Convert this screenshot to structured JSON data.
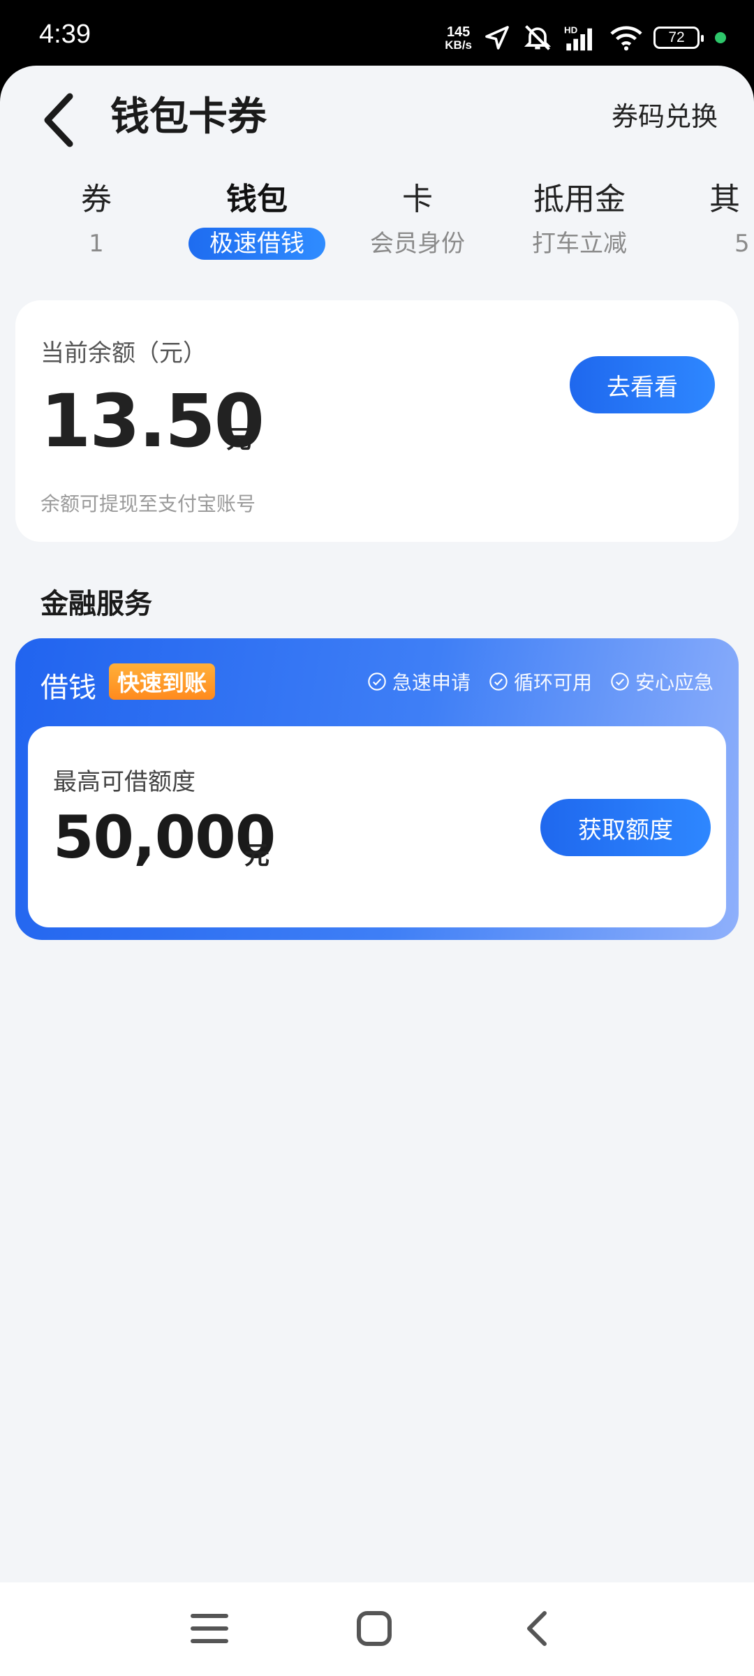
{
  "status_bar": {
    "time": "4:39",
    "net_speed_value": "145",
    "net_speed_unit": "KB/s",
    "battery": "72",
    "icons": [
      "location-arrow-icon",
      "mute-icon",
      "hd-signal-icon",
      "wifi-icon",
      "battery-icon",
      "green-dot-icon"
    ]
  },
  "header": {
    "title": "钱包卡券",
    "action_label": "券码兑换"
  },
  "tabs": [
    {
      "title": "券",
      "subtitle": "1"
    },
    {
      "title": "钱包",
      "subtitle": "极速借钱"
    },
    {
      "title": "卡",
      "subtitle": "会员身份"
    },
    {
      "title": "抵用金",
      "subtitle": "打车立减"
    },
    {
      "title": "其",
      "subtitle": "5"
    }
  ],
  "balance": {
    "label": "当前余额（元）",
    "amount": "13.50",
    "unit": "元",
    "note": "余额可提现至支付宝账号",
    "button_label": "去看看"
  },
  "finance": {
    "section_title": "金融服务",
    "loan_title": "借钱",
    "loan_tag": "快速到账",
    "features": [
      "急速申请",
      "循环可用",
      "安心应急"
    ],
    "limit_label": "最高可借额度",
    "limit_amount": "50,000",
    "limit_unit": "元",
    "button_label": "获取额度"
  },
  "colors": {
    "accent": "#1f68ee",
    "tag_orange": "#ff8a1d",
    "background": "#f3f5f8"
  }
}
